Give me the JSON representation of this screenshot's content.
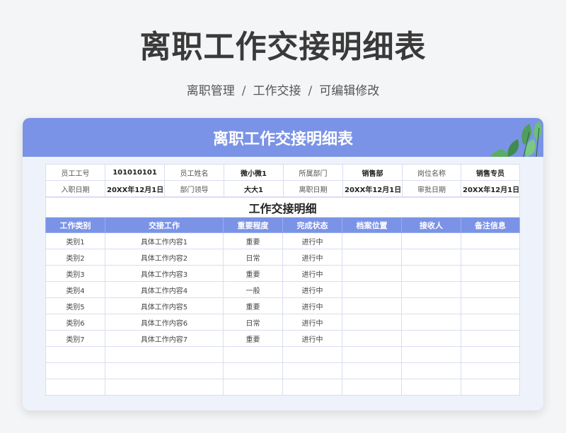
{
  "page": {
    "title": "离职工作交接明细表",
    "breadcrumb": [
      "离职管理",
      "工作交接",
      "可编辑修改"
    ]
  },
  "card": {
    "title": "离职工作交接明细表"
  },
  "info": {
    "rows": [
      [
        {
          "label": "员工工号",
          "value": "101010101"
        },
        {
          "label": "员工姓名",
          "value": "微小微1"
        },
        {
          "label": "所属部门",
          "value": "销售部"
        },
        {
          "label": "岗位名称",
          "value": "销售专员"
        }
      ],
      [
        {
          "label": "入职日期",
          "value": "20XX年12月1日"
        },
        {
          "label": "部门领导",
          "value": "大大1"
        },
        {
          "label": "离职日期",
          "value": "20XX年12月1日"
        },
        {
          "label": "审批日期",
          "value": "20XX年12月1日"
        }
      ]
    ]
  },
  "section": {
    "title": "工作交接明细"
  },
  "table": {
    "headers": [
      "工作类别",
      "交接工作",
      "重要程度",
      "完成状态",
      "档案位置",
      "接收人",
      "备注信息"
    ],
    "rows": [
      [
        "类别1",
        "具体工作内容1",
        "重要",
        "进行中",
        "",
        "",
        ""
      ],
      [
        "类别2",
        "具体工作内容2",
        "日常",
        "进行中",
        "",
        "",
        ""
      ],
      [
        "类别3",
        "具体工作内容3",
        "重要",
        "进行中",
        "",
        "",
        ""
      ],
      [
        "类别4",
        "具体工作内容4",
        "一般",
        "进行中",
        "",
        "",
        ""
      ],
      [
        "类别5",
        "具体工作内容5",
        "重要",
        "进行中",
        "",
        "",
        ""
      ],
      [
        "类别6",
        "具体工作内容6",
        "日常",
        "进行中",
        "",
        "",
        ""
      ],
      [
        "类别7",
        "具体工作内容7",
        "重要",
        "进行中",
        "",
        "",
        ""
      ],
      [
        "",
        "",
        "",
        "",
        "",
        "",
        ""
      ],
      [
        "",
        "",
        "",
        "",
        "",
        "",
        ""
      ],
      [
        "",
        "",
        "",
        "",
        "",
        "",
        ""
      ]
    ]
  },
  "colors": {
    "accent": "#7b93e6",
    "card_bg": "#eef2fb",
    "page_bg": "#f4f5f7"
  },
  "icons": {
    "decoration": "leaves-icon"
  }
}
